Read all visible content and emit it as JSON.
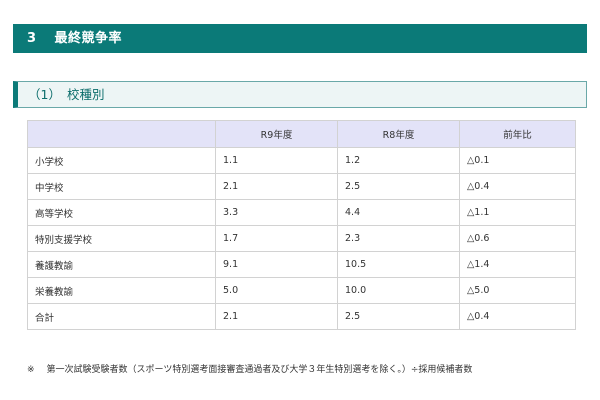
{
  "section": {
    "number": "3",
    "title": "最終競争率"
  },
  "subsection": {
    "label": "（1）",
    "title": "校種別"
  },
  "table": {
    "headers": [
      "",
      "R9年度",
      "R8年度",
      "前年比"
    ],
    "rows": [
      {
        "category": "小学校",
        "r9": "1.1",
        "r8": "1.2",
        "diff": "△0.1"
      },
      {
        "category": "中学校",
        "r9": "2.1",
        "r8": "2.5",
        "diff": "△0.4"
      },
      {
        "category": "高等学校",
        "r9": "3.3",
        "r8": "4.4",
        "diff": "△1.1"
      },
      {
        "category": "特別支援学校",
        "r9": "1.7",
        "r8": "2.3",
        "diff": "△0.6"
      },
      {
        "category": "養護教諭",
        "r9": "9.1",
        "r8": "10.5",
        "diff": "△1.4"
      },
      {
        "category": "栄養教諭",
        "r9": "5.0",
        "r8": "10.0",
        "diff": "△5.0"
      },
      {
        "category": "合計",
        "r9": "2.1",
        "r8": "2.5",
        "diff": "△0.4"
      }
    ]
  },
  "footnote": {
    "mark": "※",
    "text": "第一次試験受験者数（スポーツ特別選考面接審査通過者及び大学３年生特別選考を除く。）÷採用候補者数"
  }
}
